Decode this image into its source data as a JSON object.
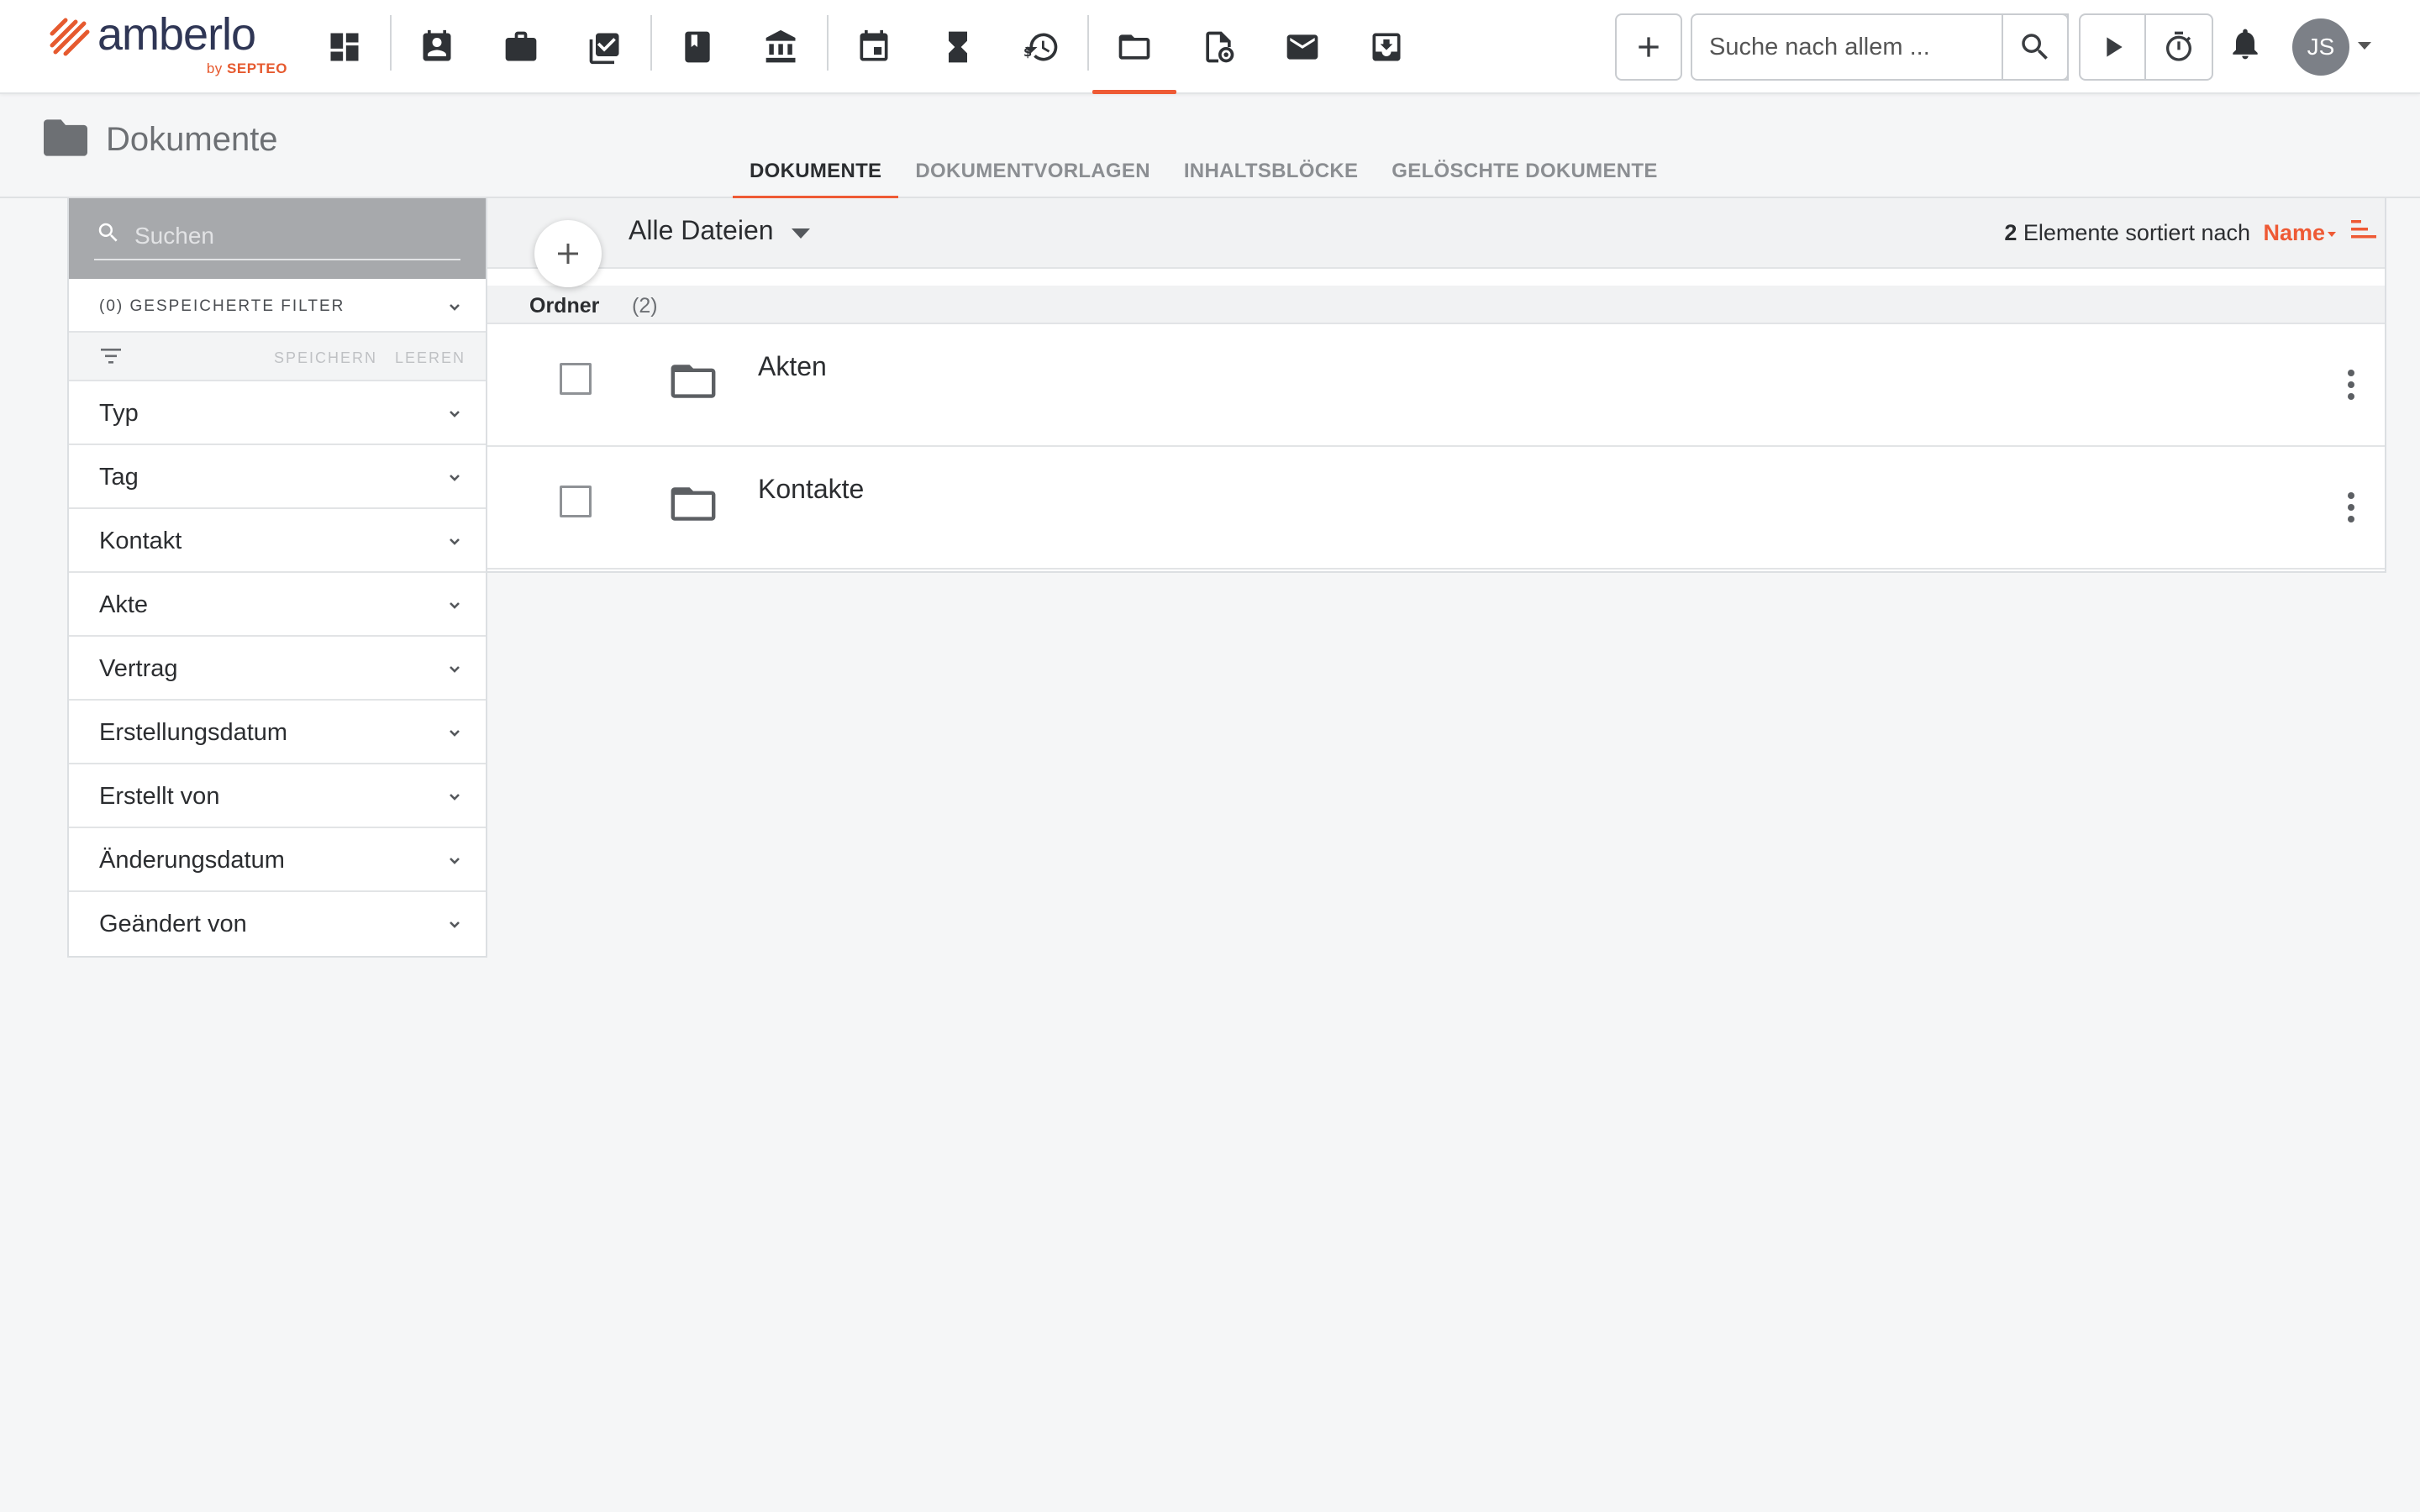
{
  "app": {
    "logo_word": "amberlo",
    "logo_by": "by",
    "logo_brand": "SEPTEO",
    "accent_color": "#ee5a35"
  },
  "topnav": {
    "icons": [
      "dashboard-icon",
      "contacts-icon",
      "matters-icon",
      "tasks-icon",
      "notebook-icon",
      "bank-icon",
      "calendar-icon",
      "hourglass-icon",
      "billing-history-icon",
      "folder-icon",
      "document-template-icon",
      "mail-icon",
      "inbox-icon"
    ],
    "active_icon": "folder-icon",
    "search_placeholder": "Suche nach allem ...",
    "user_initials": "JS"
  },
  "page": {
    "title": "Dokumente",
    "tabs": [
      {
        "label": "DOKUMENTE",
        "active": true
      },
      {
        "label": "DOKUMENTVORLAGEN",
        "active": false
      },
      {
        "label": "INHALTSBLÖCKE",
        "active": false
      },
      {
        "label": "GELÖSCHTE DOKUMENTE",
        "active": false
      }
    ]
  },
  "sidebar": {
    "search_placeholder": "Suchen",
    "saved_filters_label": "(0) GESPEICHERTE FILTER",
    "save_label": "SPEICHERN",
    "clear_label": "LEEREN",
    "filters": [
      {
        "label": "Typ"
      },
      {
        "label": "Tag"
      },
      {
        "label": "Kontakt"
      },
      {
        "label": "Akte"
      },
      {
        "label": "Vertrag"
      },
      {
        "label": "Erstellungsdatum"
      },
      {
        "label": "Erstellt von"
      },
      {
        "label": "Änderungsdatum"
      },
      {
        "label": "Geändert von"
      }
    ]
  },
  "list": {
    "view_label": "Alle Dateien",
    "count": "2",
    "sort_text": "Elemente sortiert nach",
    "sort_field": "Name",
    "group_name": "Ordner",
    "group_count": "(2)",
    "items": [
      {
        "name": "Akten"
      },
      {
        "name": "Kontakte"
      }
    ]
  }
}
